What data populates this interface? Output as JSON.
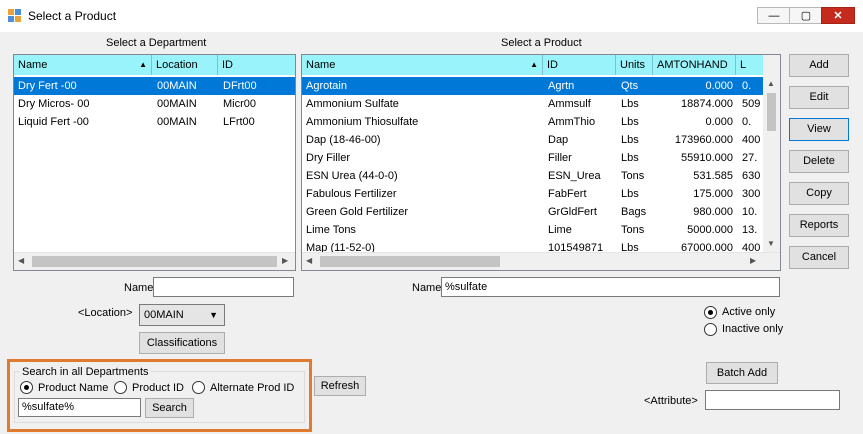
{
  "window": {
    "title": "Select a Product",
    "minimize": "—",
    "maximize": "▢",
    "close": "✕"
  },
  "department": {
    "heading": "Select a Department",
    "columns": [
      "Name",
      "Location",
      "ID"
    ],
    "rows": [
      {
        "name": "Dry Fert -00",
        "location": "00MAIN",
        "id": "DFrt00",
        "selected": true
      },
      {
        "name": "Dry Micros- 00",
        "location": "00MAIN",
        "id": "Micr00"
      },
      {
        "name": "Liquid Fert -00",
        "location": "00MAIN",
        "id": "LFrt00"
      }
    ],
    "name_label": "Name",
    "name_value": "",
    "location_label": "<Location>",
    "location_value": "00MAIN",
    "classifications_button": "Classifications"
  },
  "product": {
    "heading": "Select a Product",
    "columns": [
      "Name",
      "ID",
      "Units",
      "AMTONHAND",
      "L"
    ],
    "rows": [
      {
        "name": "Agrotain",
        "id": "Agrtn",
        "units": "Qts",
        "amt": "0.000",
        "last": "0.",
        "selected": true
      },
      {
        "name": "Ammonium Sulfate",
        "id": "Ammsulf",
        "units": "Lbs",
        "amt": "18874.000",
        "last": "509"
      },
      {
        "name": "Ammonium Thiosulfate",
        "id": "AmmThio",
        "units": "Lbs",
        "amt": "0.000",
        "last": "0."
      },
      {
        "name": "Dap (18-46-00)",
        "id": "Dap",
        "units": "Lbs",
        "amt": "173960.000",
        "last": "400"
      },
      {
        "name": "Dry Filler",
        "id": "Filler",
        "units": "Lbs",
        "amt": "55910.000",
        "last": "27."
      },
      {
        "name": "ESN Urea (44-0-0)",
        "id": "ESN_Urea",
        "units": "Tons",
        "amt": "531.585",
        "last": "630"
      },
      {
        "name": "Fabulous Fertilizer",
        "id": "FabFert",
        "units": "Lbs",
        "amt": "175.000",
        "last": "300"
      },
      {
        "name": "Green Gold Fertilizer",
        "id": "GrGldFert",
        "units": "Bags",
        "amt": "980.000",
        "last": "10."
      },
      {
        "name": "Lime Tons",
        "id": "Lime",
        "units": "Tons",
        "amt": "5000.000",
        "last": "13."
      },
      {
        "name": "Map (11-52-0)",
        "id": "101549871",
        "units": "Lbs",
        "amt": "67000.000",
        "last": "400"
      }
    ],
    "name_label": "Name",
    "name_value": "%sulfate",
    "active_only": "Active only",
    "inactive_only": "Inactive only",
    "batch_add_button": "Batch Add",
    "attribute_label": "<Attribute>",
    "attribute_value": ""
  },
  "side_buttons": [
    "Add",
    "Edit",
    "View",
    "Delete",
    "Copy",
    "Reports",
    "Cancel"
  ],
  "search": {
    "group_title": "Search in all Departments",
    "product_name": "Product Name",
    "product_id": "Product ID",
    "alternate_prod_id": "Alternate Prod ID",
    "value": "%sulfate%",
    "search_button": "Search"
  },
  "refresh_button": "Refresh"
}
